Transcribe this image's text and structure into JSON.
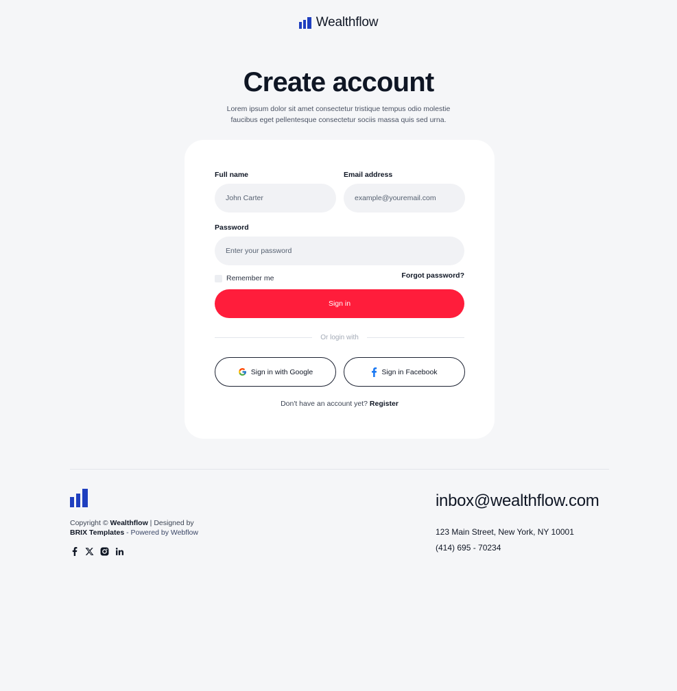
{
  "brand": {
    "name": "Wealthflow",
    "accent": "#1f3fbf",
    "primary": "#ff1d3b"
  },
  "hero": {
    "title": "Create account",
    "subtitle": "Lorem ipsum dolor sit amet consectetur tristique tempus odio molestie faucibus eget pellentesque consectetur sociis massa quis sed urna."
  },
  "form": {
    "full_name": {
      "label": "Full name",
      "placeholder": "John Carter"
    },
    "email": {
      "label": "Email address",
      "placeholder": "example@youremail.com"
    },
    "password": {
      "label": "Password",
      "placeholder": "Enter your password"
    },
    "remember_label": "Remember me",
    "forgot_label": "Forgot password?",
    "submit_label": "Sign in",
    "divider_text": "Or login with",
    "google_label": "Sign in with Google",
    "facebook_label": "Sign in Facebook",
    "register_prompt": "Don't have an account yet?",
    "register_label": "Register"
  },
  "footer": {
    "copyright_prefix": "Copyright ©",
    "copyright_brand": "Wealthflow",
    "designed_by": "| Designed by",
    "brix": "BRIX Templates",
    "powered_by": "- Powered by Webflow",
    "email": "inbox@wealthflow.com",
    "address": "123 Main Street, New York, NY 10001",
    "phone": "(414) 695 - 70234",
    "socials": [
      "facebook-icon",
      "x-icon",
      "instagram-icon",
      "linkedin-icon"
    ]
  }
}
